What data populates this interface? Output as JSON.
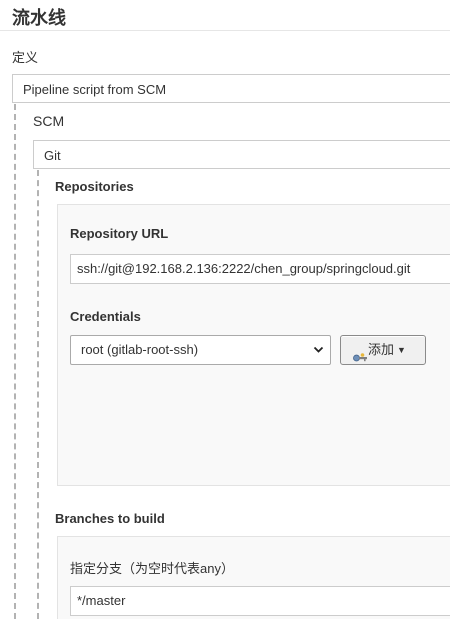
{
  "section": {
    "title": "流水线"
  },
  "definition": {
    "label": "定义",
    "value": "Pipeline script from SCM"
  },
  "scm": {
    "label": "SCM",
    "value": "Git"
  },
  "repositories": {
    "label": "Repositories",
    "repo_url_label": "Repository URL",
    "repo_url_value": "ssh://git@192.168.2.136:2222/chen_group/springcloud.git",
    "credentials_label": "Credentials",
    "credentials_value": "root (gitlab-root-ssh)",
    "add_button_label": "添加"
  },
  "branches": {
    "label": "Branches to build",
    "specifier_label": "指定分支（为空时代表any）",
    "specifier_value": "*/master"
  },
  "icons": [
    "chevron-down-icon",
    "key-icon",
    "caret-down-icon"
  ]
}
